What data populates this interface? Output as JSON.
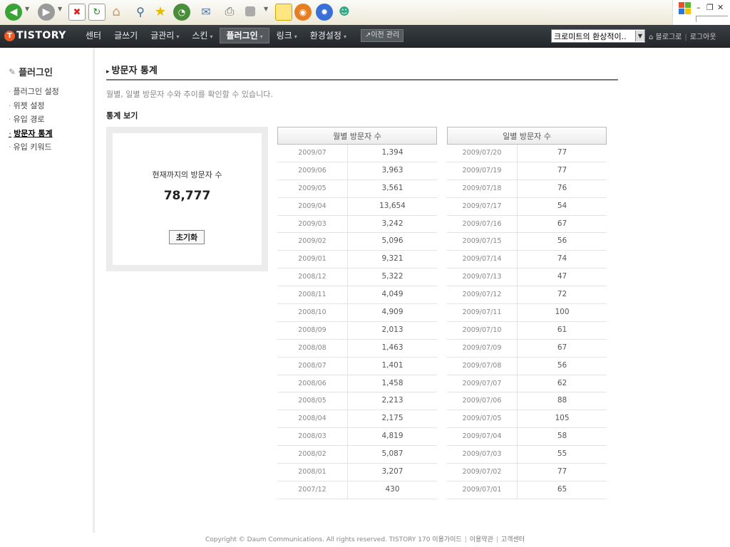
{
  "colors": {
    "header_bg": "#2b2f33",
    "logo_accent": "#f15a22",
    "sidebar_border": "#ececec",
    "box_bg": "#ececec"
  },
  "browser_toolbar": {
    "icons": [
      "back-icon",
      "forward-icon",
      "stop-icon",
      "refresh-icon",
      "home-icon",
      "search-icon",
      "favorites-icon",
      "history-icon",
      "mail-icon",
      "print-icon",
      "edit-icon",
      "notes-icon",
      "media-icon",
      "settings-icon",
      "messenger-icon"
    ]
  },
  "header": {
    "logo_text": "TISTORY",
    "nav": [
      {
        "label": "센터"
      },
      {
        "label": "글쓰기"
      },
      {
        "label": "글관리"
      },
      {
        "label": "스킨"
      },
      {
        "label": "플러그인"
      },
      {
        "label": "링크"
      },
      {
        "label": "환경설정"
      }
    ],
    "old_admin_label": "이전 관리",
    "blog_select_value": "크로미트의 환상적이..",
    "blog_link": "블로그로",
    "logout_link": "로그아웃"
  },
  "sidebar": {
    "title": "플러그인",
    "items": [
      {
        "label": "플러그인 설정"
      },
      {
        "label": "위젯 설정"
      },
      {
        "label": "유입 경로"
      },
      {
        "label": "방문자 통계"
      },
      {
        "label": "유입 키워드"
      }
    ]
  },
  "main": {
    "title": "방문자 통계",
    "description": "월별, 일별 방문자 수와 추이를 확인할 수 있습니다.",
    "section_title": "통계 보기",
    "total_label": "현재까지의 방문자 수",
    "total_value": "78,777",
    "reset_label": "초기화",
    "monthly": {
      "header": "월별 방문자 수",
      "rows": [
        {
          "date": "2009/07",
          "count": "1,394"
        },
        {
          "date": "2009/06",
          "count": "3,963"
        },
        {
          "date": "2009/05",
          "count": "3,561"
        },
        {
          "date": "2009/04",
          "count": "13,654"
        },
        {
          "date": "2009/03",
          "count": "3,242"
        },
        {
          "date": "2009/02",
          "count": "5,096"
        },
        {
          "date": "2009/01",
          "count": "9,321"
        },
        {
          "date": "2008/12",
          "count": "5,322"
        },
        {
          "date": "2008/11",
          "count": "4,049"
        },
        {
          "date": "2008/10",
          "count": "4,909"
        },
        {
          "date": "2008/09",
          "count": "2,013"
        },
        {
          "date": "2008/08",
          "count": "1,463"
        },
        {
          "date": "2008/07",
          "count": "1,401"
        },
        {
          "date": "2008/06",
          "count": "1,458"
        },
        {
          "date": "2008/05",
          "count": "2,213"
        },
        {
          "date": "2008/04",
          "count": "2,175"
        },
        {
          "date": "2008/03",
          "count": "4,819"
        },
        {
          "date": "2008/02",
          "count": "5,087"
        },
        {
          "date": "2008/01",
          "count": "3,207"
        },
        {
          "date": "2007/12",
          "count": "430"
        }
      ]
    },
    "daily": {
      "header": "일별 방문자 수",
      "rows": [
        {
          "date": "2009/07/20",
          "count": "77"
        },
        {
          "date": "2009/07/19",
          "count": "77"
        },
        {
          "date": "2009/07/18",
          "count": "76"
        },
        {
          "date": "2009/07/17",
          "count": "54"
        },
        {
          "date": "2009/07/16",
          "count": "67"
        },
        {
          "date": "2009/07/15",
          "count": "56"
        },
        {
          "date": "2009/07/14",
          "count": "74"
        },
        {
          "date": "2009/07/13",
          "count": "47"
        },
        {
          "date": "2009/07/12",
          "count": "72"
        },
        {
          "date": "2009/07/11",
          "count": "100"
        },
        {
          "date": "2009/07/10",
          "count": "61"
        },
        {
          "date": "2009/07/09",
          "count": "67"
        },
        {
          "date": "2009/07/08",
          "count": "56"
        },
        {
          "date": "2009/07/07",
          "count": "62"
        },
        {
          "date": "2009/07/06",
          "count": "88"
        },
        {
          "date": "2009/07/05",
          "count": "105"
        },
        {
          "date": "2009/07/04",
          "count": "58"
        },
        {
          "date": "2009/07/03",
          "count": "55"
        },
        {
          "date": "2009/07/02",
          "count": "77"
        },
        {
          "date": "2009/07/01",
          "count": "65"
        }
      ]
    }
  },
  "footer": {
    "copyright": "Copyright © Daum Communications. All rights reserved. TISTORY 170",
    "links": [
      {
        "label": "이용가이드"
      },
      {
        "label": "이용약관"
      },
      {
        "label": "고객센터"
      }
    ]
  }
}
